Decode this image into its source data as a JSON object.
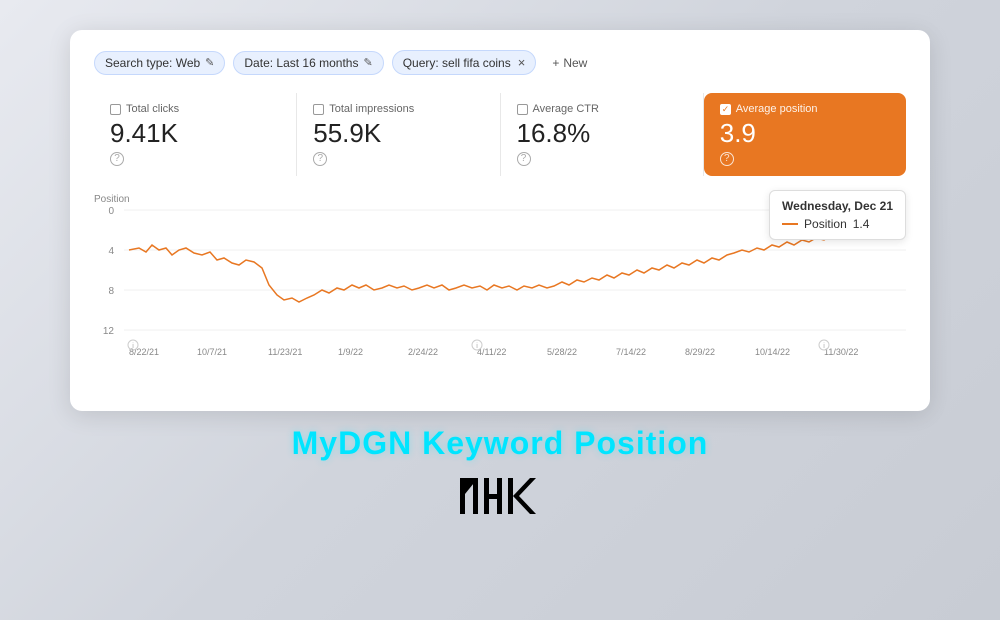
{
  "filters": {
    "search_type": "Search type: Web",
    "date": "Date: Last 16 months",
    "query": "Query: sell fifa coins",
    "new_label": "New",
    "edit_icon": "✎",
    "close_icon": "×",
    "plus_icon": "+"
  },
  "metrics": {
    "total_clicks": {
      "label": "Total clicks",
      "value": "9.41K"
    },
    "total_impressions": {
      "label": "Total impressions",
      "value": "55.9K"
    },
    "average_ctr": {
      "label": "Average CTR",
      "value": "16.8%"
    },
    "average_position": {
      "label": "Average position",
      "value": "3.9"
    }
  },
  "tooltip": {
    "date": "Wednesday, Dec 21",
    "position_label": "Position",
    "position_value": "1.4"
  },
  "chart": {
    "y_label": "Position",
    "y_axis": [
      "0",
      "4",
      "8",
      "12"
    ],
    "x_axis": [
      "8/22/21",
      "10/7/21",
      "11/23/21",
      "1/9/22",
      "2/24/22",
      "4/11/22",
      "5/28/22",
      "7/14/22",
      "8/29/22",
      "10/14/22",
      "11/30/22"
    ]
  },
  "title": "MyDGN Keyword Position",
  "accent_color": "#e87722",
  "tooltip_color": "#00e5ff"
}
